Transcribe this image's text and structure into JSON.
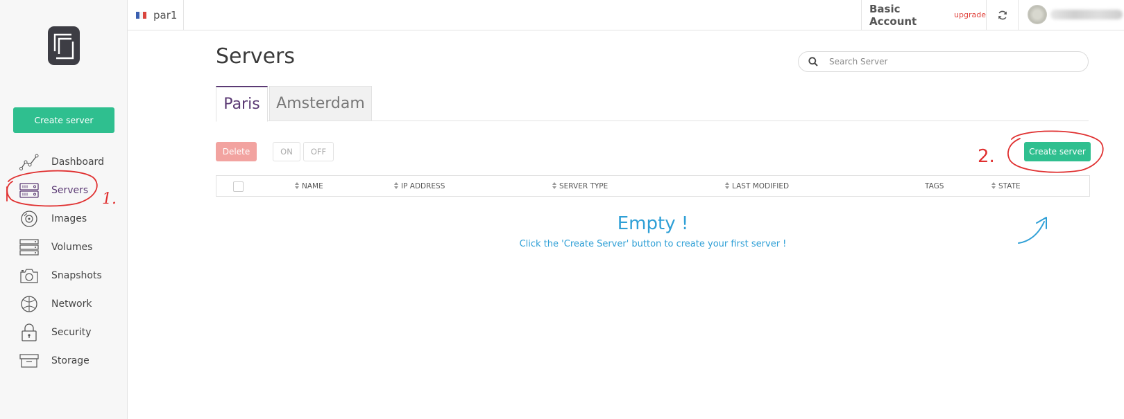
{
  "sidebar": {
    "create_label": "Create server",
    "items": [
      {
        "label": "Dashboard",
        "icon": "dashboard-icon"
      },
      {
        "label": "Servers",
        "icon": "servers-icon",
        "active": true
      },
      {
        "label": "Images",
        "icon": "images-icon"
      },
      {
        "label": "Volumes",
        "icon": "volumes-icon"
      },
      {
        "label": "Snapshots",
        "icon": "snapshots-icon"
      },
      {
        "label": "Network",
        "icon": "network-icon"
      },
      {
        "label": "Security",
        "icon": "security-icon"
      },
      {
        "label": "Storage",
        "icon": "storage-icon"
      }
    ]
  },
  "topbar": {
    "region": "par1",
    "account": "Basic Account",
    "upgrade": "upgrade"
  },
  "main": {
    "title": "Servers",
    "search_placeholder": "Search Server",
    "tabs": [
      {
        "label": "Paris",
        "active": true
      },
      {
        "label": "Amsterdam",
        "active": false
      }
    ],
    "actions": {
      "delete": "Delete",
      "on": "ON",
      "off": "OFF",
      "create": "Create server"
    },
    "table": {
      "columns": [
        "NAME",
        "IP ADDRESS",
        "SERVER TYPE",
        "LAST MODIFIED",
        "TAGS",
        "STATE"
      ]
    },
    "empty": {
      "title": "Empty !",
      "message": "Click the 'Create Server' button to create your first server !"
    }
  },
  "annotations": {
    "step1": "1.",
    "step2": "2."
  },
  "colors": {
    "accent_green": "#2fbf8f",
    "brand_purple": "#5b3a74",
    "info_blue": "#2e9fd6",
    "danger_pink": "#f2a3a0",
    "annotation_red": "#e03030"
  }
}
